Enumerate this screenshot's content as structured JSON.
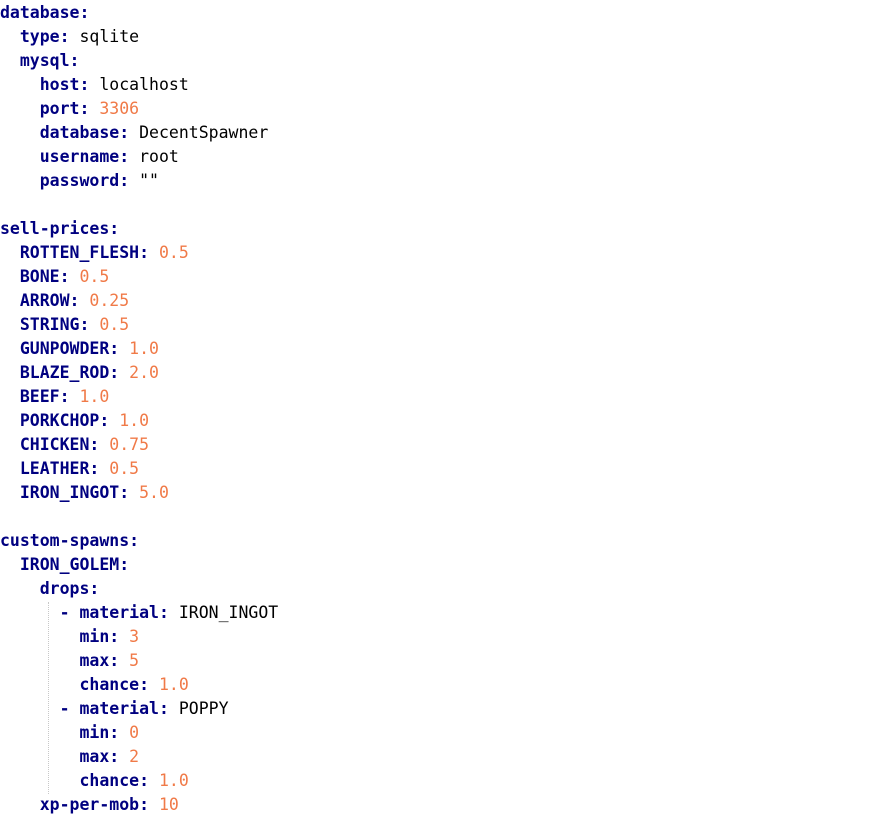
{
  "theme": {
    "key_color": "#000080",
    "string_color": "#000000",
    "number_color": "#f07a48",
    "background": "#ffffff"
  },
  "lines": [
    {
      "indent": 0,
      "key": "database",
      "sep": ":",
      "value": "",
      "vtype": ""
    },
    {
      "indent": 2,
      "key": "type",
      "sep": ":",
      "value": "sqlite",
      "vtype": "str"
    },
    {
      "indent": 2,
      "key": "mysql",
      "sep": ":",
      "value": "",
      "vtype": ""
    },
    {
      "indent": 4,
      "key": "host",
      "sep": ":",
      "value": "localhost",
      "vtype": "str"
    },
    {
      "indent": 4,
      "key": "port",
      "sep": ":",
      "value": "3306",
      "vtype": "num"
    },
    {
      "indent": 4,
      "key": "database",
      "sep": ":",
      "value": "DecentSpawner",
      "vtype": "str"
    },
    {
      "indent": 4,
      "key": "username",
      "sep": ":",
      "value": "root",
      "vtype": "str"
    },
    {
      "indent": 4,
      "key": "password",
      "sep": ":",
      "value": "\"\"",
      "vtype": "str"
    },
    {
      "blank": true
    },
    {
      "indent": 0,
      "key": "sell-prices",
      "sep": ":",
      "value": "",
      "vtype": ""
    },
    {
      "indent": 2,
      "key": "ROTTEN_FLESH",
      "sep": ":",
      "value": "0.5",
      "vtype": "num"
    },
    {
      "indent": 2,
      "key": "BONE",
      "sep": ":",
      "value": "0.5",
      "vtype": "num"
    },
    {
      "indent": 2,
      "key": "ARROW",
      "sep": ":",
      "value": "0.25",
      "vtype": "num"
    },
    {
      "indent": 2,
      "key": "STRING",
      "sep": ":",
      "value": "0.5",
      "vtype": "num"
    },
    {
      "indent": 2,
      "key": "GUNPOWDER",
      "sep": ":",
      "value": "1.0",
      "vtype": "num"
    },
    {
      "indent": 2,
      "key": "BLAZE_ROD",
      "sep": ":",
      "value": "2.0",
      "vtype": "num"
    },
    {
      "indent": 2,
      "key": "BEEF",
      "sep": ":",
      "value": "1.0",
      "vtype": "num"
    },
    {
      "indent": 2,
      "key": "PORKCHOP",
      "sep": ":",
      "value": "1.0",
      "vtype": "num"
    },
    {
      "indent": 2,
      "key": "CHICKEN",
      "sep": ":",
      "value": "0.75",
      "vtype": "num"
    },
    {
      "indent": 2,
      "key": "LEATHER",
      "sep": ":",
      "value": "0.5",
      "vtype": "num"
    },
    {
      "indent": 2,
      "key": "IRON_INGOT",
      "sep": ":",
      "value": "5.0",
      "vtype": "num"
    },
    {
      "blank": true
    },
    {
      "indent": 0,
      "key": "custom-spawns",
      "sep": ":",
      "value": "",
      "vtype": ""
    },
    {
      "indent": 2,
      "key": "IRON_GOLEM",
      "sep": ":",
      "value": "",
      "vtype": ""
    },
    {
      "indent": 4,
      "key": "drops",
      "sep": ":",
      "value": "",
      "vtype": ""
    },
    {
      "indent": 6,
      "dash": "-",
      "key": "material",
      "sep": ":",
      "value": "IRON_INGOT",
      "vtype": "str"
    },
    {
      "indent": 8,
      "key": "min",
      "sep": ":",
      "value": "3",
      "vtype": "num"
    },
    {
      "indent": 8,
      "key": "max",
      "sep": ":",
      "value": "5",
      "vtype": "num"
    },
    {
      "indent": 8,
      "key": "chance",
      "sep": ":",
      "value": "1.0",
      "vtype": "num"
    },
    {
      "indent": 6,
      "dash": "-",
      "key": "material",
      "sep": ":",
      "value": "POPPY",
      "vtype": "str"
    },
    {
      "indent": 8,
      "key": "min",
      "sep": ":",
      "value": "0",
      "vtype": "num"
    },
    {
      "indent": 8,
      "key": "max",
      "sep": ":",
      "value": "2",
      "vtype": "num"
    },
    {
      "indent": 8,
      "key": "chance",
      "sep": ":",
      "value": "1.0",
      "vtype": "num"
    },
    {
      "indent": 4,
      "key": "xp-per-mob",
      "sep": ":",
      "value": "10",
      "vtype": "num"
    }
  ]
}
